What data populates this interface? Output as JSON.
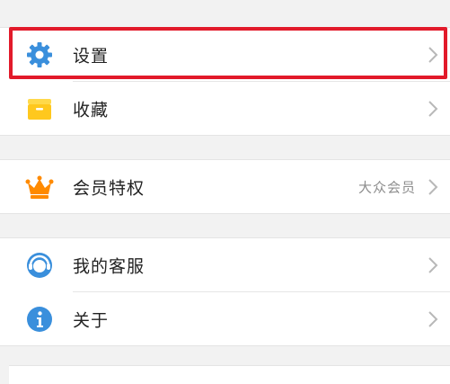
{
  "menu": {
    "settings": {
      "label": "设置",
      "icon": "gear-icon",
      "color": "#3a8fdc"
    },
    "favorites": {
      "label": "收藏",
      "icon": "folder-icon",
      "color": "#ffc81e"
    },
    "membership": {
      "label": "会员特权",
      "value": "大众会员",
      "icon": "crown-icon",
      "color": "#ff8a00"
    },
    "customer_service": {
      "label": "我的客服",
      "icon": "headset-icon",
      "color": "#3a8fdc"
    },
    "about": {
      "label": "关于",
      "icon": "info-icon",
      "color": "#3a8fdc"
    }
  },
  "highlight_color": "#e21a2a"
}
